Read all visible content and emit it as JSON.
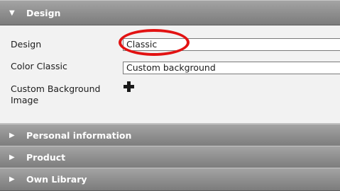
{
  "sections": {
    "design": {
      "title": "Design",
      "expanded": true
    },
    "personal": {
      "title": "Personal information",
      "expanded": false
    },
    "product": {
      "title": "Product",
      "expanded": false
    },
    "library": {
      "title": "Own Library",
      "expanded": false
    }
  },
  "arrows": {
    "expanded": "▼",
    "collapsed": "▶"
  },
  "form": {
    "design_label": "Design",
    "design_value": "Classic",
    "color_label": "Color Classic",
    "color_value": "Custom background",
    "custom_bg_label": "Custom Background Image"
  },
  "icons": {
    "section_toggle": "triangle-arrow",
    "add": "plus-icon"
  },
  "colors": {
    "header_bg": "#8f8f8f",
    "header_text": "#ffffff",
    "panel_bg": "#f2f2f2",
    "highlight": "#e21212"
  }
}
